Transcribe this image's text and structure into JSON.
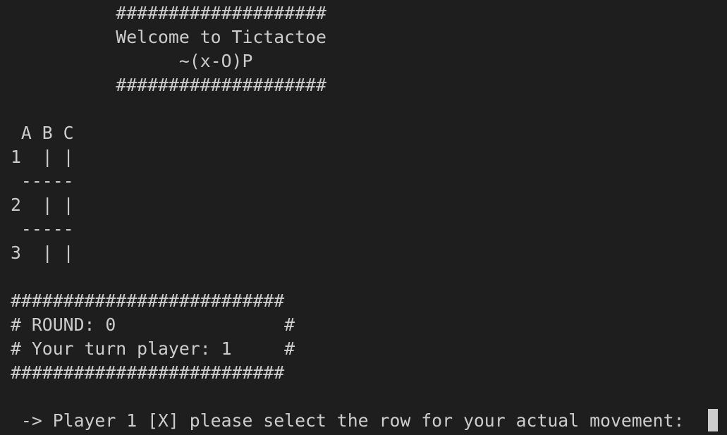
{
  "terminal": {
    "lines": [
      "          ####################",
      "          Welcome to Tictactoe",
      "                ~(x-O)P",
      "          ####################",
      "",
      " A B C",
      "1  | |",
      " -----",
      "2  | |",
      " -----",
      "3  | |",
      "",
      "##########################",
      "# ROUND: 0                #",
      "# Your turn player: 1     #",
      "##########################",
      "",
      " -> Player 1 [X] please select the row for your actual movement: "
    ]
  },
  "colors": {
    "background": "#1e1e1e",
    "foreground": "#cccccc",
    "cursor": "#cccccc"
  }
}
